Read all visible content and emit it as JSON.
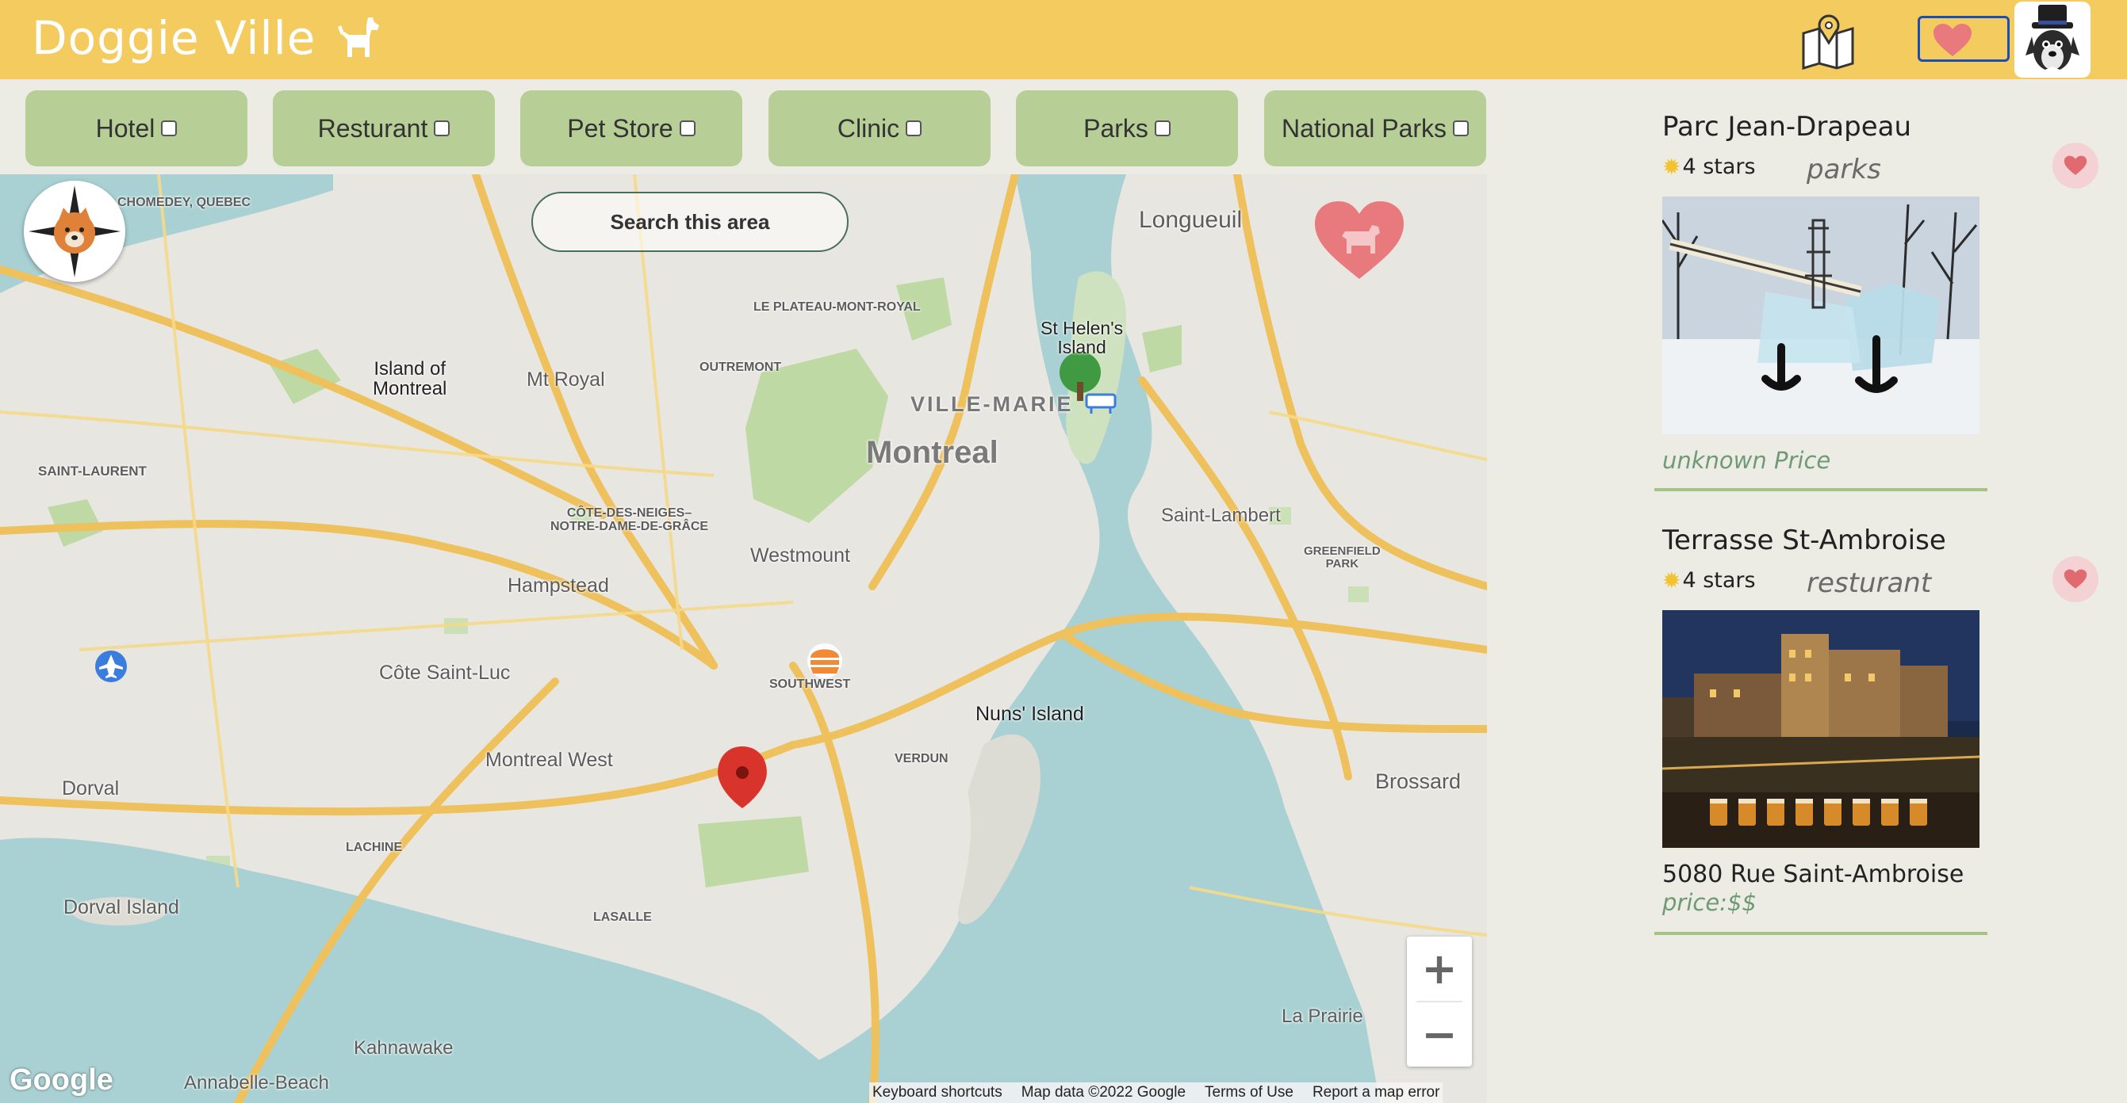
{
  "app": {
    "title": "Doggie Ville",
    "logo_icon": "dog-icon",
    "header_icons": [
      "map-pin-icon",
      "heart-icon",
      "avatar"
    ]
  },
  "colors": {
    "header": "#f4cb5e",
    "filter_button": "#b7cf96",
    "accent_green": "#6f9b74",
    "heart": "#e8797d",
    "favorites_border": "#1e4fae"
  },
  "filters": [
    {
      "label": "Hotel",
      "checked": false
    },
    {
      "label": "Resturant",
      "checked": false
    },
    {
      "label": "Pet Store",
      "checked": false
    },
    {
      "label": "Clinic",
      "checked": false
    },
    {
      "label": "Parks",
      "checked": false
    },
    {
      "label": "National Parks",
      "checked": false
    }
  ],
  "map": {
    "search_button": "Search this area",
    "labels": {
      "chomedey": "CHOMEDEY,\nQUEBEC",
      "longueuil": "Longueuil",
      "plateau": "LE PLATEAU-MONT-ROYAL",
      "st_helens": "St Helen's\nIsland",
      "island_of_montreal": "Island of\nMontreal",
      "mt_royal": "Mt Royal",
      "outremont": "OUTREMONT",
      "ville_marie": "VILLE-MARIE",
      "montreal": "Montreal",
      "saint_laurent": "SAINT-LAURENT",
      "cote_des_neiges": "CÔTE-DES-NEIGES–\nNOTRE-DAME-DE-GRÂCE",
      "saint_lambert": "Saint-Lambert",
      "westmount": "Westmount",
      "greenfield_park": "GREENFIELD\nPARK",
      "hampstead": "Hampstead",
      "cote_saint_luc": "Côte Saint-Luc",
      "southwest": "SOUTHWEST",
      "nuns_island": "Nuns' Island",
      "verdun": "VERDUN",
      "montreal_west": "Montreal West",
      "dorval": "Dorval",
      "brossard": "Brossard",
      "lachine": "LACHINE",
      "dorval_island": "Dorval Island",
      "lasalle": "LASALLE",
      "la_prairie": "La Prairie",
      "kahnawake": "Kahnawake",
      "annabelle_beach": "Annabelle-Beach"
    },
    "zoom_in": "+",
    "zoom_out": "−",
    "google": "Google",
    "attribution": {
      "keyboard": "Keyboard shortcuts",
      "map_data": "Map data ©2022 Google",
      "terms": "Terms of Use",
      "report": "Report a map error"
    }
  },
  "places": [
    {
      "name": "Parc Jean-Drapeau",
      "stars": "4 stars",
      "category": "parks",
      "price": "unknown Price",
      "address": "",
      "favorite": true
    },
    {
      "name": "Terrasse St-Ambroise",
      "stars": "4 stars",
      "category": "resturant",
      "price": "price:$$",
      "address": "5080 Rue Saint-Ambroise",
      "favorite": true
    }
  ]
}
